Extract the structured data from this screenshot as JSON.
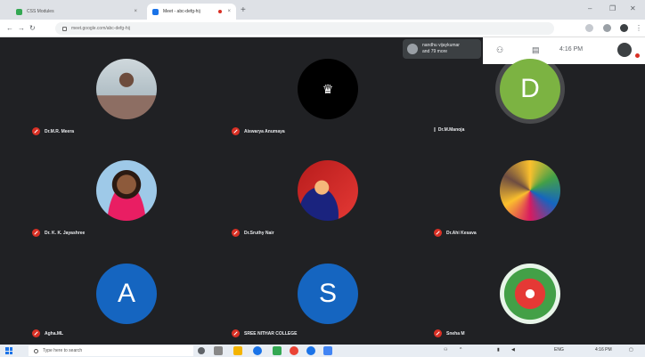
{
  "browser": {
    "tabs": [
      {
        "title": "CSS Modules",
        "favicon_color": "#34a853"
      },
      {
        "title": "Meet - abc-defg-hij",
        "favicon_color": "#1a73e8"
      }
    ],
    "close_glyph": "×",
    "new_tab_glyph": "+",
    "window_controls": [
      "–",
      "❐",
      "✕"
    ],
    "url": "meet.google.com/abc-defg-hij"
  },
  "meet": {
    "presenter": {
      "line1": "nandhu vijaykumar",
      "line2": "and 79 more"
    },
    "time": "4:16 PM",
    "participants": [
      {
        "name": "Dr.M.R. Meera",
        "avatar_type": "photo",
        "photo_theme": "podium",
        "mic_muted": true
      },
      {
        "name": "Aiswarya Anumaya",
        "avatar_type": "photo",
        "photo_theme": "crown",
        "mic_muted": true
      },
      {
        "name": "Dr.M.Manoja",
        "avatar_type": "letter",
        "letter": "D",
        "color": "#7cb342",
        "mic_muted": false,
        "speaking": true
      },
      {
        "name": "Dr. K. K. Jayashree",
        "avatar_type": "photo",
        "photo_theme": "portrait",
        "mic_muted": true
      },
      {
        "name": "Dr.Sruthy Nair",
        "avatar_type": "photo",
        "photo_theme": "red",
        "mic_muted": true
      },
      {
        "name": "Dr.Ahi Kesava",
        "avatar_type": "photo",
        "photo_theme": "painting",
        "mic_muted": true
      },
      {
        "name": "Agha.ML",
        "avatar_type": "letter",
        "letter": "A",
        "color": "#1565c0",
        "mic_muted": true
      },
      {
        "name": "SREE NITHAR COLLEGE",
        "avatar_type": "letter",
        "letter": "S",
        "color": "#1565c0",
        "mic_muted": true
      },
      {
        "name": "Sneha M",
        "avatar_type": "photo",
        "photo_theme": "flowers",
        "mic_muted": true
      }
    ]
  },
  "taskbar": {
    "search_placeholder": "Type here to search",
    "clock": "4:16 PM"
  }
}
